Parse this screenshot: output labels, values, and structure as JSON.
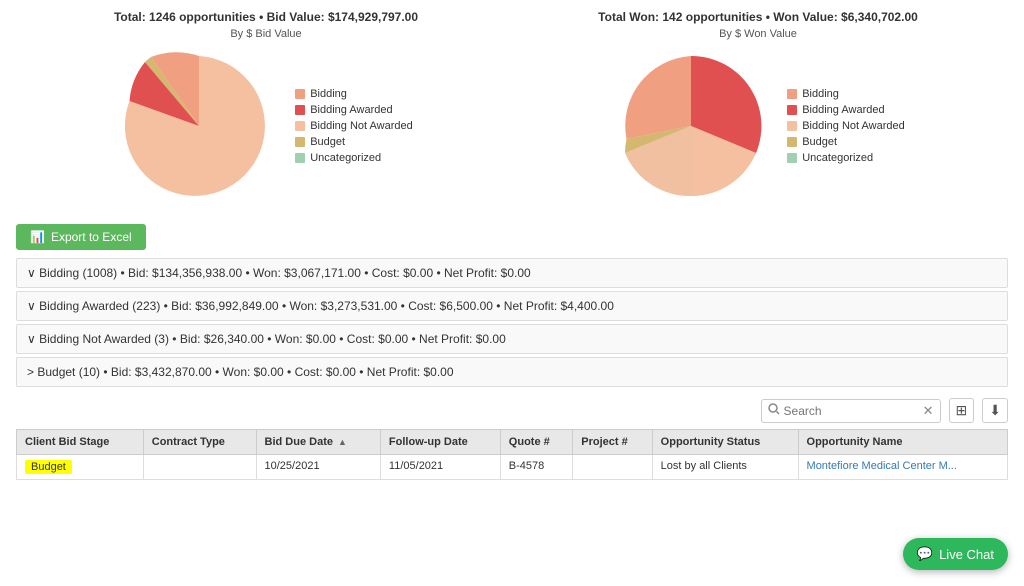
{
  "charts": {
    "left": {
      "total_label": "Total: 1246 opportunities • Bid Value: $174,929,797.00",
      "subtitle": "By $ Bid Value",
      "legend": [
        {
          "label": "Bidding",
          "color": "#f0a080"
        },
        {
          "label": "Bidding Awarded",
          "color": "#e05050"
        },
        {
          "label": "Bidding Not Awarded",
          "color": "#f5c0a0"
        },
        {
          "label": "Budget",
          "color": "#d4b870"
        },
        {
          "label": "Uncategorized",
          "color": "#a0d0b0"
        }
      ]
    },
    "right": {
      "total_label": "Total Won: 142 opportunities • Won Value: $6,340,702.00",
      "subtitle": "By $ Won Value",
      "legend": [
        {
          "label": "Bidding",
          "color": "#f0a080"
        },
        {
          "label": "Bidding Awarded",
          "color": "#e05050"
        },
        {
          "label": "Bidding Not Awarded",
          "color": "#f5c0a0"
        },
        {
          "label": "Budget",
          "color": "#d4b870"
        },
        {
          "label": "Uncategorized",
          "color": "#a0d0b0"
        }
      ]
    }
  },
  "export_btn": "Export to Excel",
  "groups": [
    {
      "label": "∨ Bidding (1008) • Bid: $134,356,938.00 • Won: $3,067,171.00 • Cost: $0.00 • Net Profit: $0.00"
    },
    {
      "label": "∨ Bidding Awarded (223) • Bid: $36,992,849.00 • Won: $3,273,531.00 • Cost: $6,500.00 • Net Profit: $4,400.00"
    },
    {
      "label": "∨ Bidding Not Awarded (3) • Bid: $26,340.00 • Won: $0.00 • Cost: $0.00 • Net Profit: $0.00"
    },
    {
      "label": "> Budget (10) • Bid: $3,432,870.00 • Won: $0.00 • Cost: $0.00 • Net Profit: $0.00"
    }
  ],
  "table": {
    "search_placeholder": "Search",
    "columns": [
      {
        "label": "Client Bid Stage"
      },
      {
        "label": "Contract Type"
      },
      {
        "label": "Bid Due Date",
        "sortable": true
      },
      {
        "label": "Follow-up Date"
      },
      {
        "label": "Quote #"
      },
      {
        "label": "Project #"
      },
      {
        "label": "Opportunity Status"
      },
      {
        "label": "Opportunity Name"
      }
    ],
    "rows": [
      {
        "client_bid_stage": "Budget",
        "client_bid_stage_badge": true,
        "contract_type": "",
        "bid_due_date": "10/25/2021",
        "followup_date": "11/05/2021",
        "quote": "B-4578",
        "project": "",
        "opp_status": "Lost by all Clients",
        "opp_name": "Montefiore Medical Center M..."
      }
    ]
  },
  "live_chat": "Live Chat"
}
